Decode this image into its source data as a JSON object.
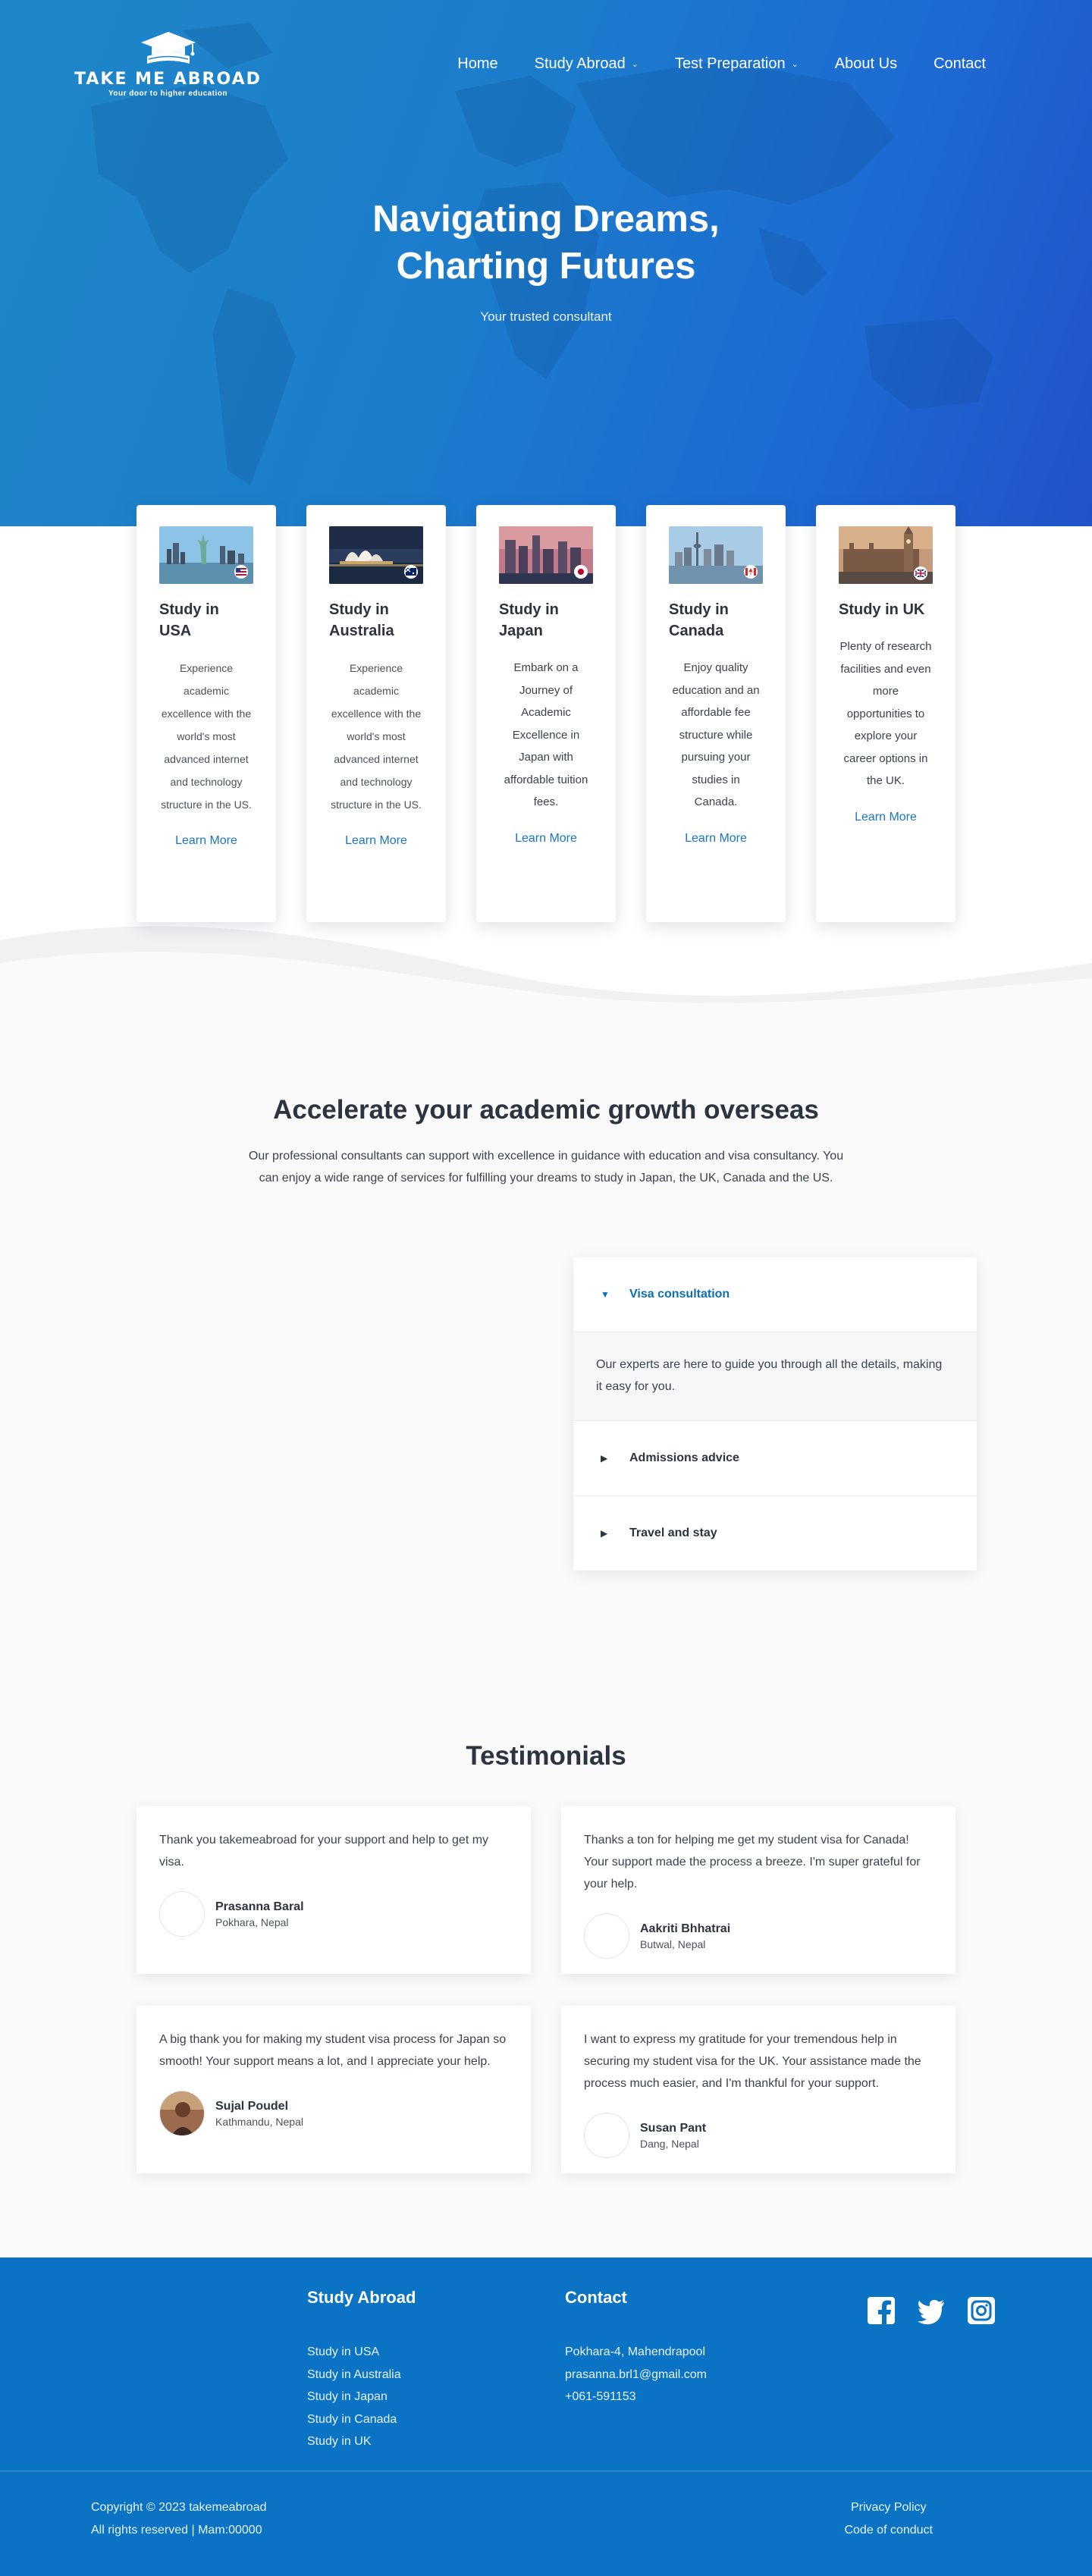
{
  "brand": {
    "name": "TAKE ME ABROAD",
    "tagline": "Your door to higher education"
  },
  "nav": {
    "items": [
      "Home",
      "Study Abroad",
      "Test Preparation",
      "About Us",
      "Contact"
    ]
  },
  "hero": {
    "title_line1": "Navigating Dreams,",
    "title_line2": "Charting Futures",
    "subtitle": "Your trusted consultant"
  },
  "study_cards": [
    {
      "title": "Study in USA",
      "desc": "Experience academic excellence with the world's most advanced internet and technology structure in the US.",
      "link": "Learn More",
      "flag": "usa-flag-icon"
    },
    {
      "title": "Study in Australia",
      "desc": "Experience academic excellence with the world's most advanced internet and technology structure in the US.",
      "link": "Learn More",
      "flag": "australia-flag-icon"
    },
    {
      "title": "Study in Japan",
      "desc": "Embark on a Journey of Academic Excellence in Japan with affordable tuition fees.",
      "link": "Learn More",
      "flag": "japan-flag-icon"
    },
    {
      "title": "Study in Canada",
      "desc": "Enjoy quality education and an affordable fee structure while pursuing your studies in Canada.",
      "link": "Learn More",
      "flag": "canada-flag-icon"
    },
    {
      "title": "Study in UK",
      "desc": "Plenty of research facilities and even more opportunities to explore your career options in the UK.",
      "link": "Learn More",
      "flag": "uk-flag-icon"
    }
  ],
  "accelerate": {
    "title": "Accelerate your academic growth overseas",
    "text": "Our professional consultants can support with excellence in guidance with education and visa consultancy. You can enjoy a wide range of services for fulfilling your dreams to study in Japan, the UK, Canada and the US.",
    "accordion": [
      {
        "label": "Visa consultation",
        "open": true,
        "body": "Our experts are here to guide you through all the details, making it easy for you."
      },
      {
        "label": "Admissions advice",
        "open": false
      },
      {
        "label": "Travel and stay",
        "open": false
      }
    ]
  },
  "testimonials": {
    "title": "Testimonials",
    "items": [
      {
        "quote": "Thank you takemeabroad for your support and help to get my visa.",
        "name": "Prasanna Baral",
        "location": "Pokhara, Nepal"
      },
      {
        "quote": "Thanks a ton for helping me get my student visa for Canada! Your support made the process a breeze. I'm super grateful for your help.",
        "name": "Aakriti Bhhatrai",
        "location": "Butwal, Nepal"
      },
      {
        "quote": "A big thank you for making my student visa process for Japan so smooth! Your support means a lot, and I appreciate your help.",
        "name": "Sujal Poudel",
        "location": "Kathmandu, Nepal"
      },
      {
        "quote": "I want to express my gratitude for your tremendous help in securing my student visa for the UK. Your assistance made the process much easier, and I'm thankful for your support.",
        "name": "Susan Pant",
        "location": "Dang, Nepal"
      }
    ]
  },
  "footer": {
    "study_heading": "Study Abroad",
    "study_links": [
      "Study in USA",
      "Study in Australia",
      "Study in Japan",
      "Study in Canada",
      "Study in UK"
    ],
    "contact_heading": "Contact",
    "address": "Pokhara-4, Mahendrapool",
    "email": "prasanna.brl1@gmail.com",
    "phone": "+061-591153",
    "social": [
      "facebook-icon",
      "twitter-icon",
      "instagram-icon"
    ],
    "copyright": "Copyright © 2023 takemeabroad",
    "rights": "All rights reserved | Mam:00000",
    "privacy": "Privacy Policy",
    "conduct": "Code of conduct"
  },
  "colors": {
    "hero_start": "#1f87c8",
    "hero_end": "#2152c9",
    "accent": "#1976c7",
    "footer_bg": "#0a73c4"
  }
}
